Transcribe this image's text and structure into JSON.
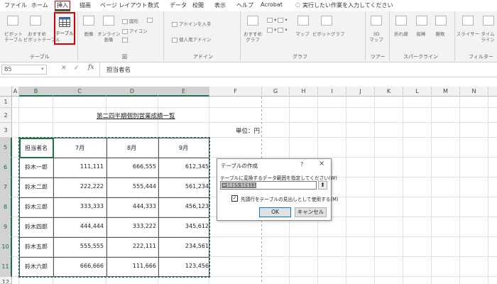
{
  "menu": {
    "items": [
      "ファイル",
      "ホーム",
      "挿入",
      "描画",
      "ページ レイアウト",
      "数式",
      "データ",
      "校閲",
      "表示",
      "ヘルプ",
      "Acrobat"
    ],
    "active": "挿入",
    "search_placeholder": "実行したい作業を入力してください"
  },
  "ribbon": {
    "pivot_table": "ピボット\nテーブル",
    "recommended_pivot": "おすすめ\nピボットテーブル",
    "table": "テーブル",
    "image": "画像",
    "online_image": "オンライン\n画像",
    "shapes": "図形",
    "icons": "アイコン",
    "get_addin": "アドインを入手",
    "personal_addin": "個人用アドイン",
    "recommended_chart": "おすすめ\nグラフ",
    "map": "マップ",
    "pivot_chart": "ピボットグラフ",
    "map3d": "3D\nマップ",
    "line": "折れ線",
    "column": "縦棒",
    "winloss": "勝敗",
    "slicer": "スライサー",
    "timeline": "タイム\nライン",
    "group_table": "テーブル",
    "group_illustration": "図",
    "group_addin": "アドイン",
    "group_chart": "グラフ",
    "group_tour": "ツアー",
    "group_sparkline": "スパークライン",
    "group_filter": "フィルター"
  },
  "formula_bar": {
    "name_box": "B5",
    "fx": "fx",
    "content": "担当者名"
  },
  "grid": {
    "columns": [
      "A",
      "B",
      "C",
      "D",
      "E",
      "F",
      "G",
      "H",
      "I",
      "J",
      "K",
      "L",
      "M",
      "N"
    ],
    "rows": [
      "1",
      "2",
      "3",
      "5",
      "6",
      "7",
      "8",
      "9",
      "10",
      "11",
      "12"
    ],
    "title": "第二四半期個別営業成績一覧",
    "unit": "単位：円",
    "headers": [
      "担当者名",
      "7月",
      "8月",
      "9月"
    ],
    "data": [
      [
        "鈴木一郎",
        "111,111",
        "666,555",
        "612,345"
      ],
      [
        "鈴木二郎",
        "222,222",
        "555,444",
        "561,234"
      ],
      [
        "鈴木三郎",
        "333,333",
        "444,333",
        "456,123"
      ],
      [
        "鈴木四郎",
        "444,444",
        "333,222",
        "345,612"
      ],
      [
        "鈴木五郎",
        "555,555",
        "222,111",
        "234,561"
      ],
      [
        "鈴木六郎",
        "666,666",
        "111,666",
        "123,456"
      ]
    ]
  },
  "dialog": {
    "title": "テーブルの作成",
    "help": "?",
    "close": "×",
    "prompt": "テーブルに変換するデータ範囲を指定してください(W)",
    "range": "=$B$5:$E$11",
    "checkbox_label": "先頭行をテーブルの見出しとして使用する(M)",
    "checkbox_checked": true,
    "ok": "OK",
    "cancel": "キャンセル"
  },
  "colors": {
    "excel_green": "#1e7145",
    "highlight_red": "#d40000"
  }
}
